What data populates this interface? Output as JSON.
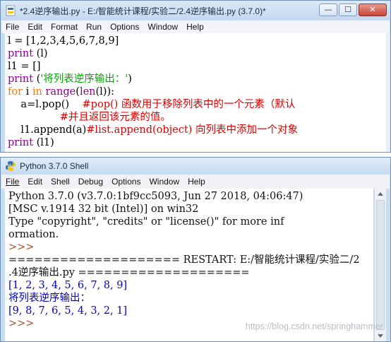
{
  "editor": {
    "title": "*2.4逆序输出.py - E:/智能统计课程/实验二/2.4逆序输出.py (3.7.0)*",
    "controls": {
      "minimize": "—",
      "maximize": "☐",
      "close": "✕"
    },
    "menu": [
      "File",
      "Edit",
      "Format",
      "Run",
      "Options",
      "Window",
      "Help"
    ],
    "code": [
      "l = [1,2,3,4,5,6,7,8,9]",
      "print (l)",
      "l1 = []",
      "print ('将列表逆序输出：')",
      "for i in range(len(l)):",
      "    a=l.pop()    #pop() 函数用于移除列表中的一个元素（默认",
      "                #并且返回该元素的值。",
      "    l1.append(a)#list.append(object) 向列表中添加一个对象",
      "print (l1)"
    ]
  },
  "shell": {
    "title": "Python 3.7.0 Shell",
    "controls": {
      "minimize": "—",
      "maximize": "☐",
      "close": "✕"
    },
    "menu": [
      "File",
      "Edit",
      "Shell",
      "Debug",
      "Options",
      "Window",
      "Help"
    ],
    "output": [
      "Python 3.7.0 (v3.7.0:1bf9cc5093, Jun 27 2018, 04:06:47)",
      "[MSC v.1914 32 bit (Intel)] on win32",
      "Type \"copyright\", \"credits\" or \"license()\" for more inf",
      "ormation.",
      ">>>",
      "==================== RESTART: E:/智能统计课程/实验二/2",
      ".4逆序输出.py ====================",
      "[1, 2, 3, 4, 5, 6, 7, 8, 9]",
      "将列表逆序输出：",
      "[9, 8, 7, 6, 5, 4, 3, 2, 1]",
      ">>>"
    ]
  },
  "watermark": "https://blog.csdn.net/springhammer",
  "colors": {
    "keyword": "#ff7700",
    "builtin": "#900090",
    "string": "#00aa00",
    "comment": "#dd0000",
    "output": "#0000d0",
    "prompt": "#a0522d"
  },
  "icons": [
    "python-file-icon",
    "python-shell-icon",
    "minimize-icon",
    "maximize-icon",
    "close-icon"
  ]
}
